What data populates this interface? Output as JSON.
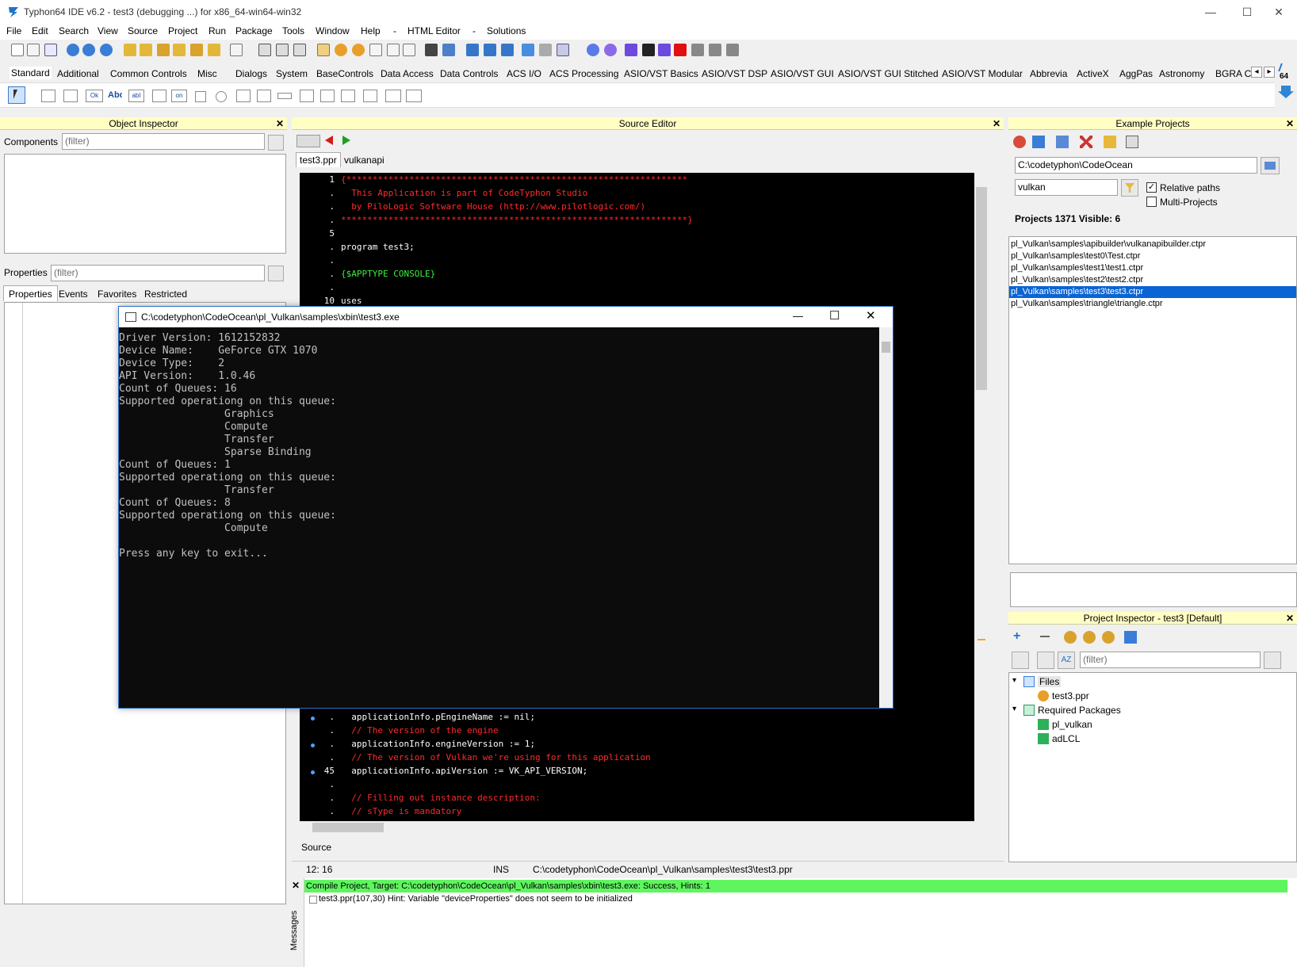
{
  "window": {
    "title": "Typhon64 IDE v6.2 - test3 (debugging ...) for x86_64-win64-win32",
    "controls": [
      "—",
      "☐",
      "✕"
    ]
  },
  "menu": [
    "File",
    "Edit",
    "Search",
    "View",
    "Source",
    "Project",
    "Run",
    "Package",
    "Tools",
    "Window",
    "Help",
    "-",
    "HTML Editor",
    "-",
    "Solutions"
  ],
  "palette": {
    "tabs": [
      "Standard",
      "Additional",
      "Common Controls",
      "Misc",
      "Dialogs",
      "System",
      "BaseControls",
      "Data Access",
      "Data Controls",
      "ACS I/O",
      "ACS Processing",
      "ASIO/VST Basics",
      "ASIO/VST DSP",
      "ASIO/VST GUI",
      "ASIO/VST GUI Stitched",
      "ASIO/VST Modular",
      "Abbrevia",
      "ActiveX",
      "AggPas",
      "Astronomy",
      "BGRA C"
    ],
    "nav_left": "◂",
    "nav_right": "▸",
    "arch_label": "64",
    "component_labels": [
      "Ok",
      "Abc",
      "abI",
      "on"
    ]
  },
  "object_inspector": {
    "title": "Object Inspector",
    "close": "✕",
    "components_label": "Components",
    "components_filter": "(filter)",
    "properties_label": "Properties",
    "properties_filter": "(filter)",
    "tabs": [
      "Properties",
      "Events",
      "Favorites",
      "Restricted"
    ]
  },
  "source_editor": {
    "title": "Source Editor",
    "close": "✕",
    "tabs": [
      "test3.ppr",
      "vulkanapi"
    ],
    "bottom_tab": "Source",
    "top_lines": [
      {
        "ln": "1",
        "text": "{*****************************************************************",
        "color": "#ff2a2a"
      },
      {
        "ln": ".",
        "text": "  This Application is part of CodeTyphon Studio",
        "color": "#ff2a2a"
      },
      {
        "ln": ".",
        "text": "  by PiloLogic Software House (http://www.pilotlogic.com/)",
        "color": "#ff2a2a"
      },
      {
        "ln": ".",
        "text": "******************************************************************}",
        "color": "#ff2a2a"
      },
      {
        "ln": "5",
        "text": "",
        "color": "#ffffff"
      },
      {
        "ln": ".",
        "text": "program test3;",
        "color": "#ffffff"
      },
      {
        "ln": ".",
        "text": "",
        "color": "#ffffff"
      },
      {
        "ln": ".",
        "text": "{$APPTYPE CONSOLE}",
        "color": "#3cf03c"
      },
      {
        "ln": ".",
        "text": "",
        "color": "#ffffff"
      },
      {
        "ln": "10",
        "text": "uses",
        "color": "#ffffff"
      }
    ],
    "bottom_lines": [
      {
        "ln": ".",
        "bp": true,
        "text": "  applicationInfo.pEngineName := nil;",
        "color": "#ffffff"
      },
      {
        "ln": ".",
        "bp": false,
        "text": "  // The version of the engine",
        "color": "#ff2a2a"
      },
      {
        "ln": ".",
        "bp": true,
        "text": "  applicationInfo.engineVersion := 1;",
        "color": "#ffffff"
      },
      {
        "ln": ".",
        "bp": false,
        "text": "  // The version of Vulkan we're using for this application",
        "color": "#ff2a2a"
      },
      {
        "ln": "45",
        "bp": true,
        "text": "  applicationInfo.apiVersion := VK_API_VERSION;",
        "color": "#ffffff"
      },
      {
        "ln": ".",
        "bp": false,
        "text": "",
        "color": "#ffffff"
      },
      {
        "ln": ".",
        "bp": false,
        "text": "  // Filling out instance description:",
        "color": "#ff2a2a"
      },
      {
        "ln": ".",
        "bp": false,
        "text": "  // sType is mandatory",
        "color": "#ff2a2a"
      }
    ],
    "status": {
      "position": "12: 16",
      "mode": "INS",
      "file": "C:\\codetyphon\\CodeOcean\\pl_Vulkan\\samples\\test3\\test3.ppr"
    }
  },
  "console": {
    "title": "C:\\codetyphon\\CodeOcean\\pl_Vulkan\\samples\\xbin\\test3.exe",
    "controls": [
      "—",
      "☐",
      "✕"
    ],
    "lines": [
      "Driver Version: 1612152832",
      "Device Name:    GeForce GTX 1070",
      "Device Type:    2",
      "API Version:    1.0.46",
      "Count of Queues: 16",
      "Supported operationg on this queue:",
      "                 Graphics",
      "                 Compute",
      "                 Transfer",
      "                 Sparse Binding",
      "Count of Queues: 1",
      "Supported operationg on this queue:",
      "                 Transfer",
      "Count of Queues: 8",
      "Supported operationg on this queue:",
      "                 Compute",
      "",
      "Press any key to exit..."
    ]
  },
  "example_projects": {
    "title": "Example Projects",
    "close": "✕",
    "path": "C:\\codetyphon\\CodeOcean",
    "filter": "vulkan",
    "relative_paths_label": "Relative paths",
    "relative_paths_checked": true,
    "multi_projects_label": "Multi-Projects",
    "multi_projects_checked": false,
    "summary": "Projects 1371  Visible: 6",
    "items": [
      "pl_Vulkan\\samples\\apibuilder\\vulkanapibuilder.ctpr",
      "pl_Vulkan\\samples\\test0\\Test.ctpr",
      "pl_Vulkan\\samples\\test1\\test1.ctpr",
      "pl_Vulkan\\samples\\test2\\test2.ctpr",
      "pl_Vulkan\\samples\\test3\\test3.ctpr",
      "pl_Vulkan\\samples\\triangle\\triangle.ctpr"
    ],
    "selected_index": 4
  },
  "project_inspector": {
    "title": "Project Inspector - test3 [Default]",
    "close": "✕",
    "filter": "(filter)",
    "files_label": "Files",
    "file": "test3.ppr",
    "required_label": "Required Packages",
    "packages": [
      "pl_vulkan",
      "adLCL"
    ]
  },
  "messages": {
    "side_label": "Messages",
    "close": "✕",
    "success": "Compile Project, Target: C:\\codetyphon\\CodeOcean\\pl_Vulkan\\samples\\xbin\\test3.exe: Success, Hints: 1",
    "hint": "test3.ppr(107,30) Hint: Variable \"deviceProperties\" does not seem to be initialized"
  },
  "colors": {
    "panel_header": "#ffffc4",
    "selection": "#0a64d4",
    "success": "#5ff55f",
    "console_bg": "#0c0c0c"
  }
}
